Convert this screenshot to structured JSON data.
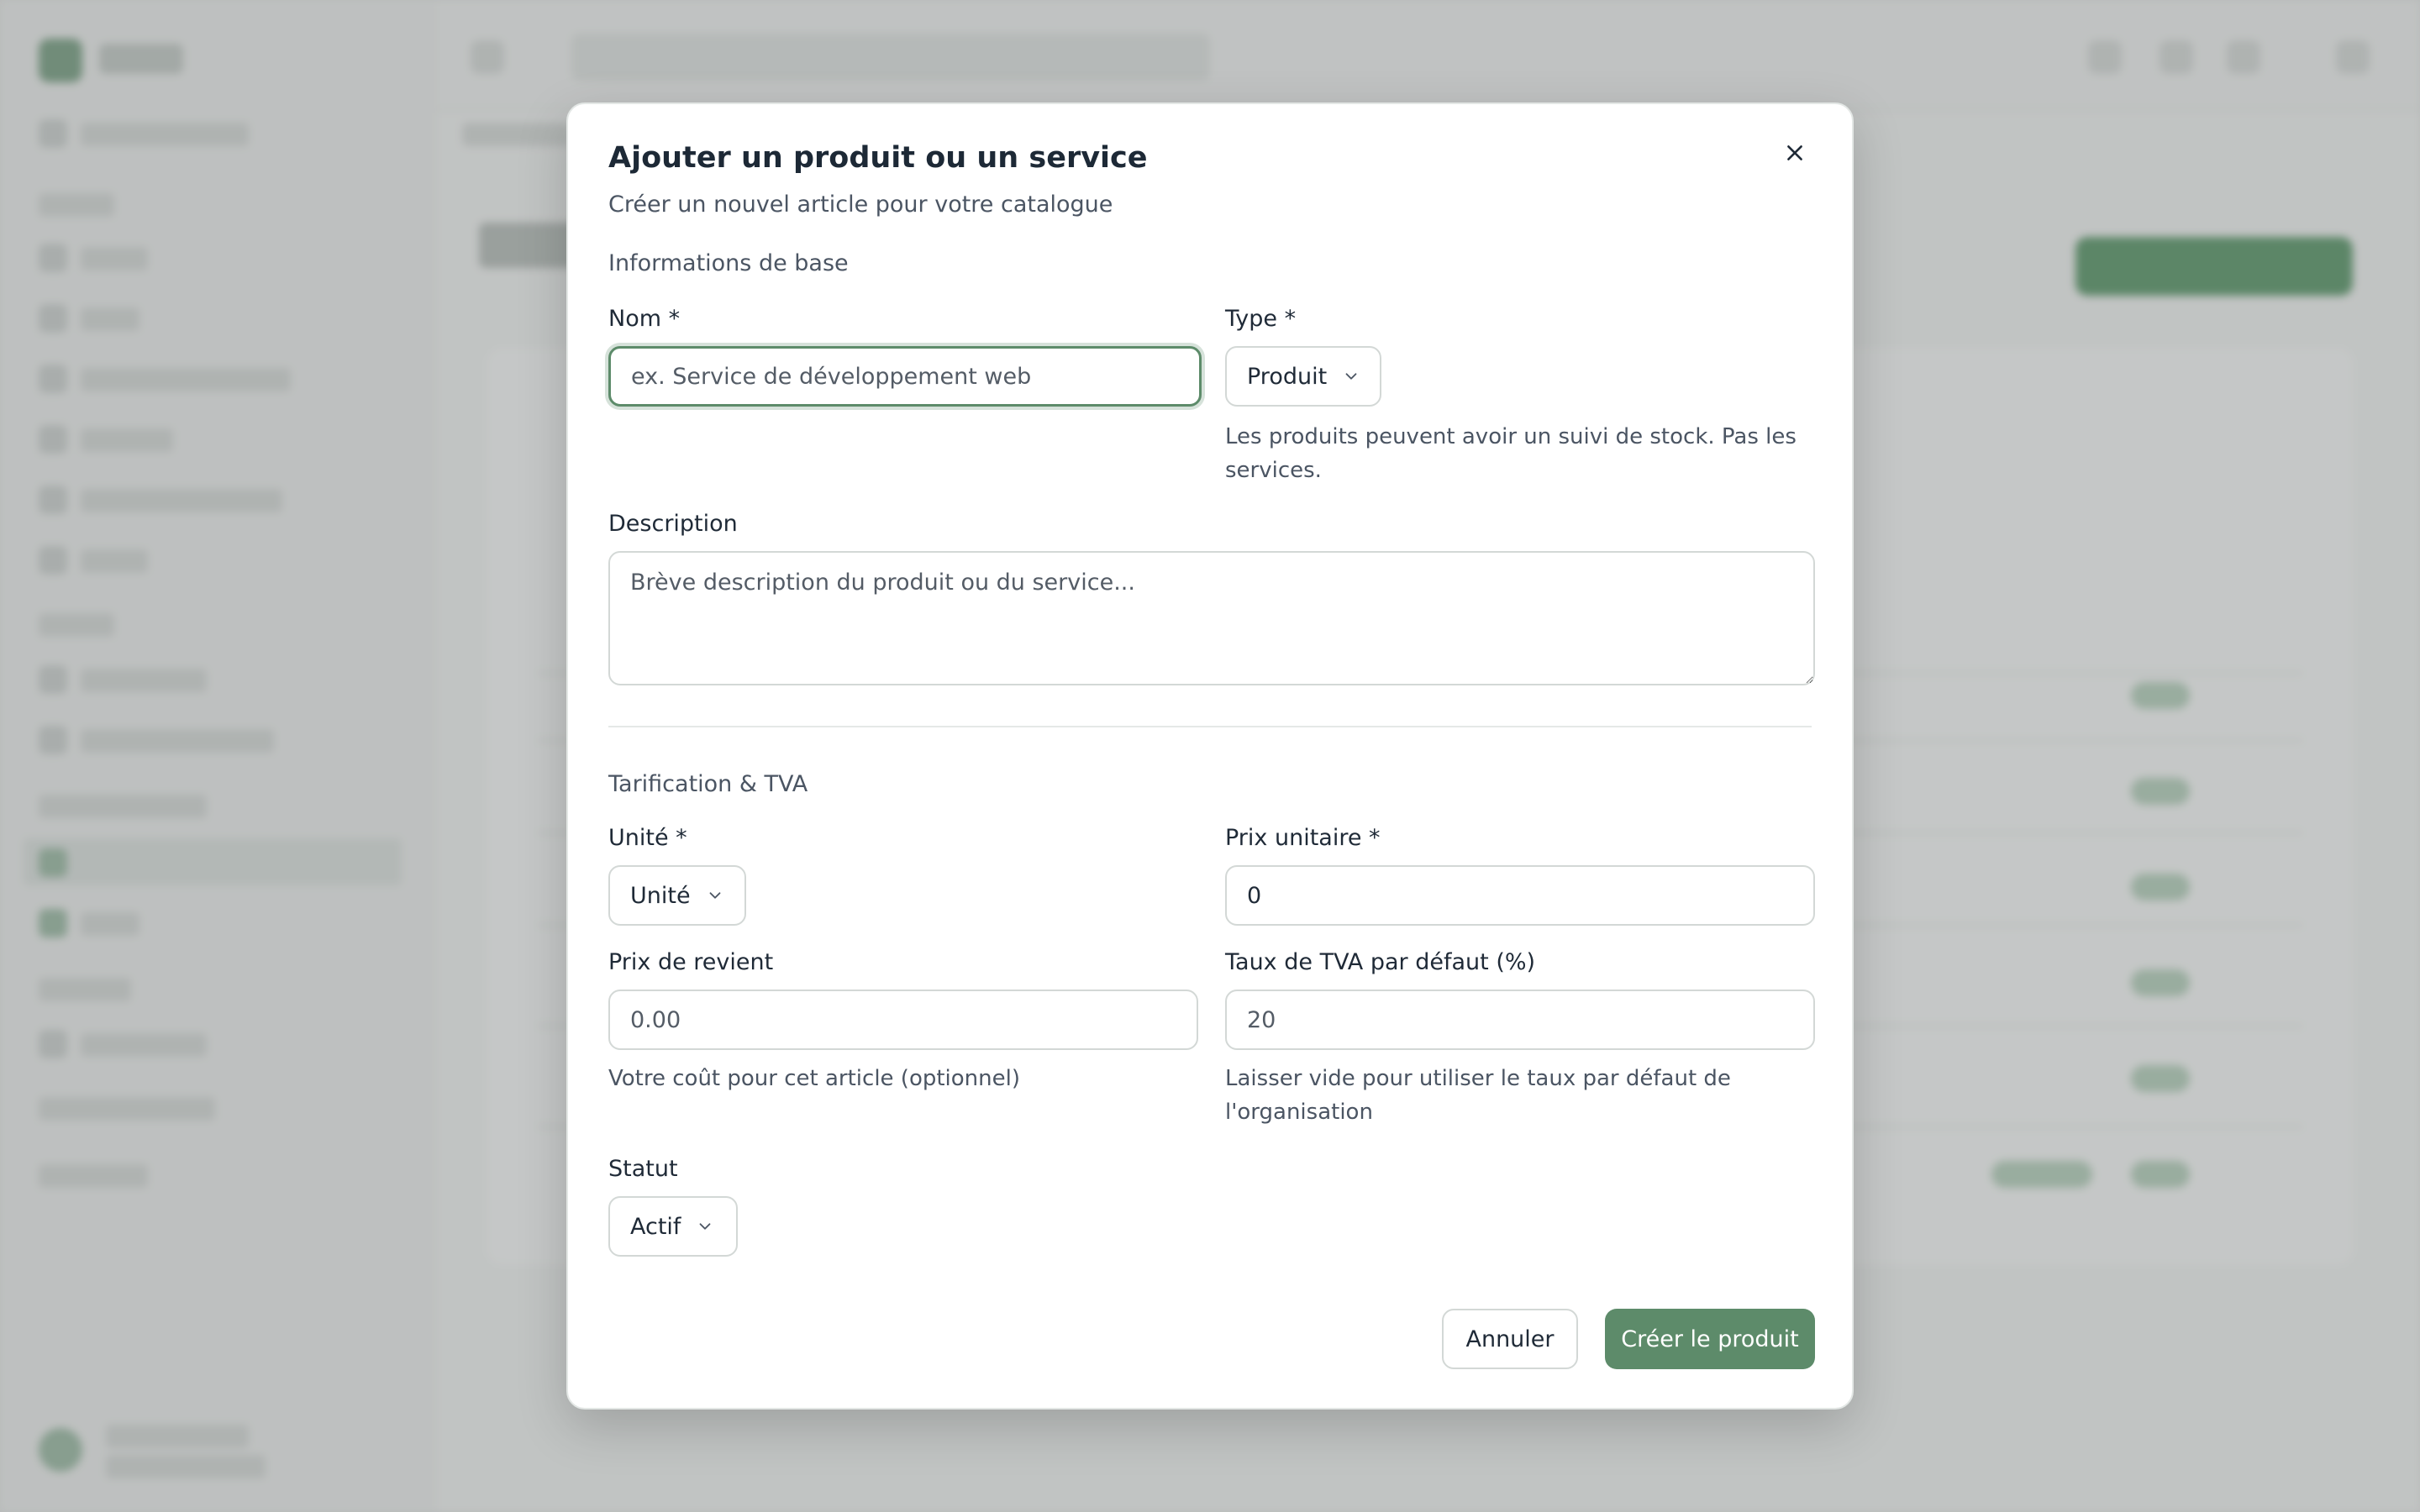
{
  "modal": {
    "title": "Ajouter un produit ou un service",
    "subtitle": "Créer un nouvel article pour votre catalogue",
    "close_icon": "close-icon"
  },
  "basic_info": {
    "section_title": "Informations de base",
    "name": {
      "label": "Nom *",
      "placeholder": "ex. Service de développement web",
      "value": ""
    },
    "type": {
      "label": "Type *",
      "value": "Produit",
      "help": "Les produits peuvent avoir un suivi de stock. Pas les services."
    },
    "description": {
      "label": "Description",
      "placeholder": "Brève description du produit ou du service...",
      "value": ""
    }
  },
  "pricing": {
    "section_title": "Tarification & TVA",
    "unit": {
      "label": "Unité *",
      "value": "Unité"
    },
    "unit_price": {
      "label": "Prix unitaire *",
      "value": "0"
    },
    "cost_price": {
      "label": "Prix de revient",
      "placeholder": "0.00",
      "help": "Votre coût pour cet article (optionnel)"
    },
    "vat_rate": {
      "label": "Taux de TVA par défaut (%)",
      "placeholder": "20",
      "help": "Laisser vide pour utiliser le taux par défaut de l'organisation"
    }
  },
  "status": {
    "label": "Statut",
    "value": "Actif"
  },
  "actions": {
    "cancel_label": "Annuler",
    "submit_label": "Créer le produit"
  },
  "colors": {
    "accent": "#5d8b6a",
    "overlay": "#787d7b"
  }
}
